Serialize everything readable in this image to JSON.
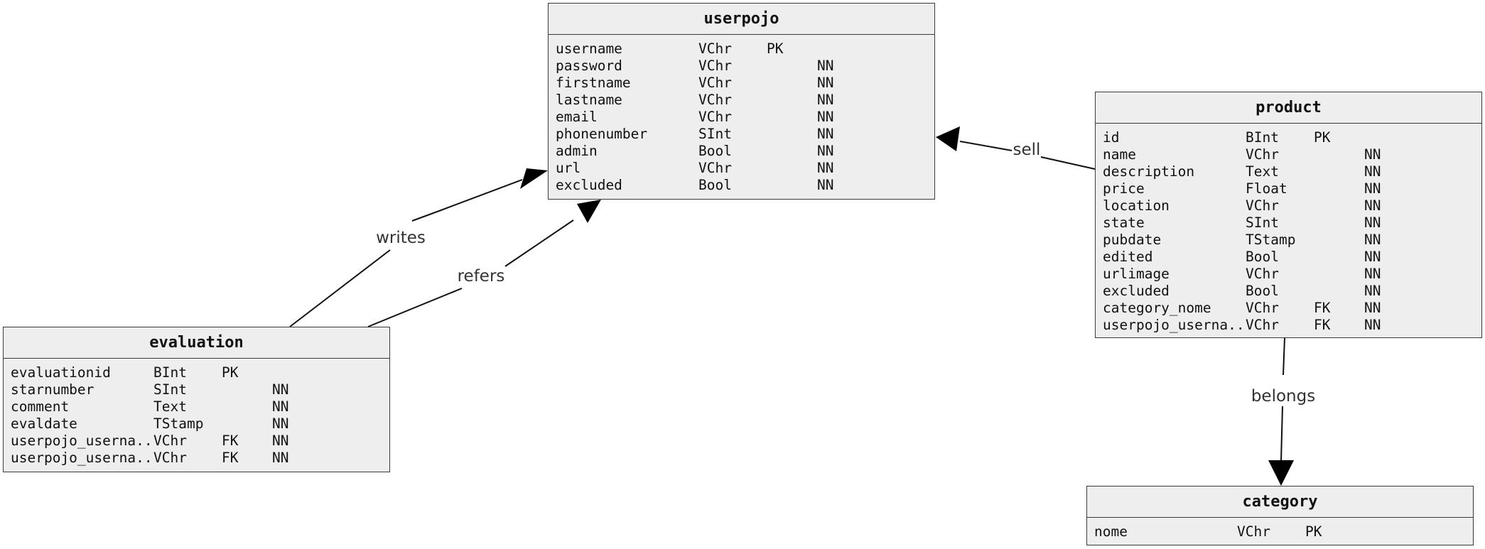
{
  "entities": [
    {
      "title": "userpojo",
      "rows": [
        {
          "name": "username",
          "type": "VChr",
          "key": "PK",
          "null": ""
        },
        {
          "name": "password",
          "type": "VChr",
          "key": "",
          "null": "NN"
        },
        {
          "name": "firstname",
          "type": "VChr",
          "key": "",
          "null": "NN"
        },
        {
          "name": "lastname",
          "type": "VChr",
          "key": "",
          "null": "NN"
        },
        {
          "name": "email",
          "type": "VChr",
          "key": "",
          "null": "NN"
        },
        {
          "name": "phonenumber",
          "type": "SInt",
          "key": "",
          "null": "NN"
        },
        {
          "name": "admin",
          "type": "Bool",
          "key": "",
          "null": "NN"
        },
        {
          "name": "url",
          "type": "VChr",
          "key": "",
          "null": "NN"
        },
        {
          "name": "excluded",
          "type": "Bool",
          "key": "",
          "null": "NN"
        }
      ]
    },
    {
      "title": "product",
      "rows": [
        {
          "name": "id",
          "type": "BInt",
          "key": "PK",
          "null": ""
        },
        {
          "name": "name",
          "type": "VChr",
          "key": "",
          "null": "NN"
        },
        {
          "name": "description",
          "type": "Text",
          "key": "",
          "null": "NN"
        },
        {
          "name": "price",
          "type": "Float",
          "key": "",
          "null": "NN"
        },
        {
          "name": "location",
          "type": "VChr",
          "key": "",
          "null": "NN"
        },
        {
          "name": "state",
          "type": "SInt",
          "key": "",
          "null": "NN"
        },
        {
          "name": "pubdate",
          "type": "TStamp",
          "key": "",
          "null": "NN"
        },
        {
          "name": "edited",
          "type": "Bool",
          "key": "",
          "null": "NN"
        },
        {
          "name": "urlimage",
          "type": "VChr",
          "key": "",
          "null": "NN"
        },
        {
          "name": "excluded",
          "type": "Bool",
          "key": "",
          "null": "NN"
        },
        {
          "name": "category_nome",
          "type": "VChr",
          "key": "FK",
          "null": "NN"
        },
        {
          "name": "userpojo_userna..",
          "type": "VChr",
          "key": "FK",
          "null": "NN"
        }
      ]
    },
    {
      "title": "evaluation",
      "rows": [
        {
          "name": "evaluationid",
          "type": "BInt",
          "key": "PK",
          "null": ""
        },
        {
          "name": "starnumber",
          "type": "SInt",
          "key": "",
          "null": "NN"
        },
        {
          "name": "comment",
          "type": "Text",
          "key": "",
          "null": "NN"
        },
        {
          "name": "evaldate",
          "type": "TStamp",
          "key": "",
          "null": "NN"
        },
        {
          "name": "userpojo_userna..",
          "type": "VChr",
          "key": "FK",
          "null": "NN"
        },
        {
          "name": "userpojo_userna..",
          "type": "VChr",
          "key": "FK",
          "null": "NN"
        }
      ]
    },
    {
      "title": "category",
      "rows": [
        {
          "name": "nome",
          "type": "VChr",
          "key": "PK",
          "null": ""
        }
      ]
    }
  ],
  "relationships": [
    {
      "label": "sell",
      "from": "product",
      "to": "userpojo"
    },
    {
      "label": "writes",
      "from": "evaluation",
      "to": "userpojo"
    },
    {
      "label": "refers",
      "from": "evaluation",
      "to": "userpojo"
    },
    {
      "label": "belongs",
      "from": "product",
      "to": "category"
    }
  ]
}
